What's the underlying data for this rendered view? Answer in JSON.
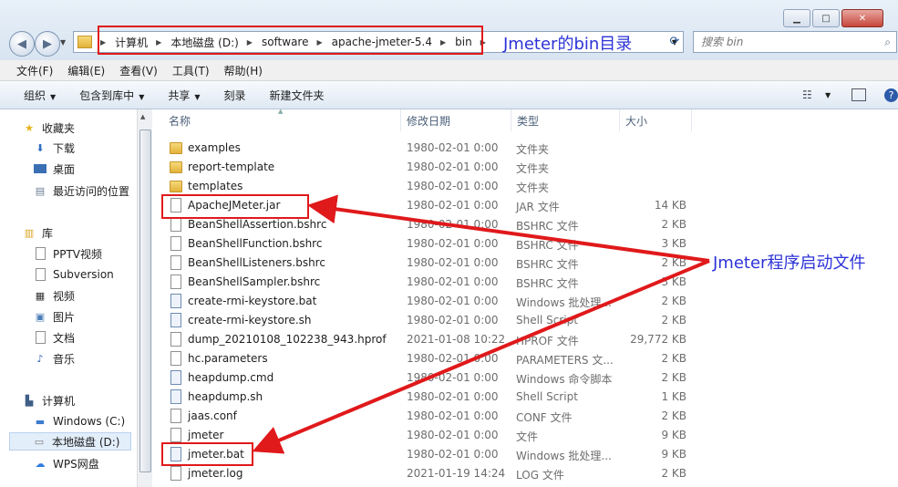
{
  "window": {
    "minimize": "▁",
    "maximize": "□",
    "close": "✕"
  },
  "address": {
    "crumbs": [
      "计算机",
      "本地磁盘 (D:)",
      "software",
      "apache-jmeter-5.4",
      "bin"
    ],
    "separator": "▶"
  },
  "search": {
    "placeholder": "搜索 bin"
  },
  "menu": [
    "文件(F)",
    "编辑(E)",
    "查看(V)",
    "工具(T)",
    "帮助(H)"
  ],
  "toolbar": {
    "organize": "组织",
    "include": "包含到库中",
    "share": "共享",
    "burn": "刻录",
    "new_folder": "新建文件夹",
    "dropdown": "▼"
  },
  "nav": {
    "favorites": "收藏夹",
    "fav_items": [
      "下载",
      "桌面",
      "最近访问的位置"
    ],
    "libraries": "库",
    "lib_items": [
      "PPTV视频",
      "Subversion",
      "视频",
      "图片",
      "文档",
      "音乐"
    ],
    "computer": "计算机",
    "drives": [
      "Windows (C:)",
      "本地磁盘 (D:)",
      "WPS网盘"
    ]
  },
  "columns": [
    "名称",
    "修改日期",
    "类型",
    "大小"
  ],
  "files": [
    {
      "name": "examples",
      "date": "1980-02-01 0:00",
      "type": "文件夹",
      "size": "",
      "icon": "folder"
    },
    {
      "name": "report-template",
      "date": "1980-02-01 0:00",
      "type": "文件夹",
      "size": "",
      "icon": "folder"
    },
    {
      "name": "templates",
      "date": "1980-02-01 0:00",
      "type": "文件夹",
      "size": "",
      "icon": "folder"
    },
    {
      "name": "ApacheJMeter.jar",
      "date": "1980-02-01 0:00",
      "type": "JAR 文件",
      "size": "14 KB",
      "icon": "doc"
    },
    {
      "name": "BeanShellAssertion.bshrc",
      "date": "1980-02-01 0:00",
      "type": "BSHRC 文件",
      "size": "2 KB",
      "icon": "doc"
    },
    {
      "name": "BeanShellFunction.bshrc",
      "date": "1980-02-01 0:00",
      "type": "BSHRC 文件",
      "size": "3 KB",
      "icon": "doc"
    },
    {
      "name": "BeanShellListeners.bshrc",
      "date": "1980-02-01 0:00",
      "type": "BSHRC 文件",
      "size": "2 KB",
      "icon": "doc"
    },
    {
      "name": "BeanShellSampler.bshrc",
      "date": "1980-02-01 0:00",
      "type": "BSHRC 文件",
      "size": "3 KB",
      "icon": "doc"
    },
    {
      "name": "create-rmi-keystore.bat",
      "date": "1980-02-01 0:00",
      "type": "Windows 批处理...",
      "size": "2 KB",
      "icon": "bat"
    },
    {
      "name": "create-rmi-keystore.sh",
      "date": "1980-02-01 0:00",
      "type": "Shell Script",
      "size": "2 KB",
      "icon": "bat"
    },
    {
      "name": "dump_20210108_102238_943.hprof",
      "date": "2021-01-08 10:22",
      "type": "HPROF 文件",
      "size": "29,772 KB",
      "icon": "doc"
    },
    {
      "name": "hc.parameters",
      "date": "1980-02-01 0:00",
      "type": "PARAMETERS 文...",
      "size": "2 KB",
      "icon": "doc"
    },
    {
      "name": "heapdump.cmd",
      "date": "1980-02-01 0:00",
      "type": "Windows 命令脚本",
      "size": "2 KB",
      "icon": "bat"
    },
    {
      "name": "heapdump.sh",
      "date": "1980-02-01 0:00",
      "type": "Shell Script",
      "size": "1 KB",
      "icon": "bat"
    },
    {
      "name": "jaas.conf",
      "date": "1980-02-01 0:00",
      "type": "CONF 文件",
      "size": "2 KB",
      "icon": "doc"
    },
    {
      "name": "jmeter",
      "date": "1980-02-01 0:00",
      "type": "文件",
      "size": "9 KB",
      "icon": "doc"
    },
    {
      "name": "jmeter.bat",
      "date": "1980-02-01 0:00",
      "type": "Windows 批处理...",
      "size": "9 KB",
      "icon": "bat"
    },
    {
      "name": "jmeter.log",
      "date": "2021-01-19 14:24",
      "type": "LOG 文件",
      "size": "2 KB",
      "icon": "doc"
    }
  ],
  "annotations": {
    "bin_dir": "Jmeter的bin目录",
    "launch_files": "Jmeter程序启动文件",
    "color": "#2c32d7",
    "box_color": "#e0191b"
  }
}
